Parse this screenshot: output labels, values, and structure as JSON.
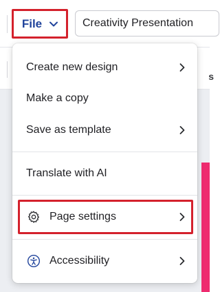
{
  "header": {
    "file_label": "File",
    "design_title": "Creativity Presentation"
  },
  "toolbar2": {
    "partial_text": "s"
  },
  "file_menu": {
    "items": [
      {
        "label": "Create new design",
        "has_submenu": true
      },
      {
        "label": "Make a copy",
        "has_submenu": false
      },
      {
        "label": "Save as template",
        "has_submenu": true
      },
      {
        "label": "Translate with AI",
        "has_submenu": false
      },
      {
        "label": "Page settings",
        "has_submenu": true,
        "icon": "gear-icon",
        "highlighted": true
      },
      {
        "label": "Accessibility",
        "has_submenu": true,
        "icon": "accessibility-icon"
      }
    ]
  },
  "colors": {
    "highlight_border": "#d4212c",
    "file_label": "#21449c",
    "pink_accent": "#ee2b6f"
  }
}
